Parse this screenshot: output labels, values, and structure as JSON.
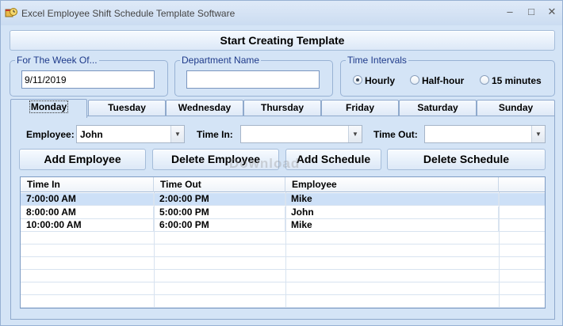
{
  "window": {
    "title": "Excel Employee Shift Schedule Template Software",
    "min_glyph": "–",
    "max_glyph": "□",
    "close_glyph": "✕"
  },
  "start_button": "Start Creating Template",
  "week": {
    "label": "For The Week Of...",
    "value": "9/11/2019"
  },
  "department": {
    "label": "Department Name",
    "value": ""
  },
  "intervals": {
    "label": "Time Intervals",
    "options": [
      {
        "label": "Hourly",
        "selected": true
      },
      {
        "label": "Half-hour",
        "selected": false
      },
      {
        "label": "15 minutes",
        "selected": false
      }
    ]
  },
  "tabs": [
    "Monday",
    "Tuesday",
    "Wednesday",
    "Thursday",
    "Friday",
    "Saturday",
    "Sunday"
  ],
  "active_tab": "Monday",
  "form": {
    "employee_label": "Employee:",
    "employee_value": "John",
    "time_in_label": "Time In:",
    "time_in_value": "",
    "time_out_label": "Time Out:",
    "time_out_value": ""
  },
  "actions": {
    "add_employee": "Add Employee",
    "delete_employee": "Delete Employee",
    "add_schedule": "Add Schedule",
    "delete_schedule": "Delete Schedule"
  },
  "table": {
    "columns": [
      "Time In",
      "Time Out",
      "Employee",
      ""
    ],
    "rows": [
      [
        "7:00:00 AM",
        "2:00:00 PM",
        "Mike"
      ],
      [
        "8:00:00 AM",
        "5:00:00 PM",
        "John"
      ],
      [
        "10:00:00 AM",
        "6:00:00 PM",
        "Mike"
      ]
    ]
  },
  "watermark": "Download",
  "icons": {
    "app": "calendar-clock-icon",
    "dropdown": "chevron-down-icon"
  },
  "colors": {
    "window_bg": "#d4e4f6",
    "group_title": "#1e3a8a",
    "selected_row": "#cde0f7"
  }
}
